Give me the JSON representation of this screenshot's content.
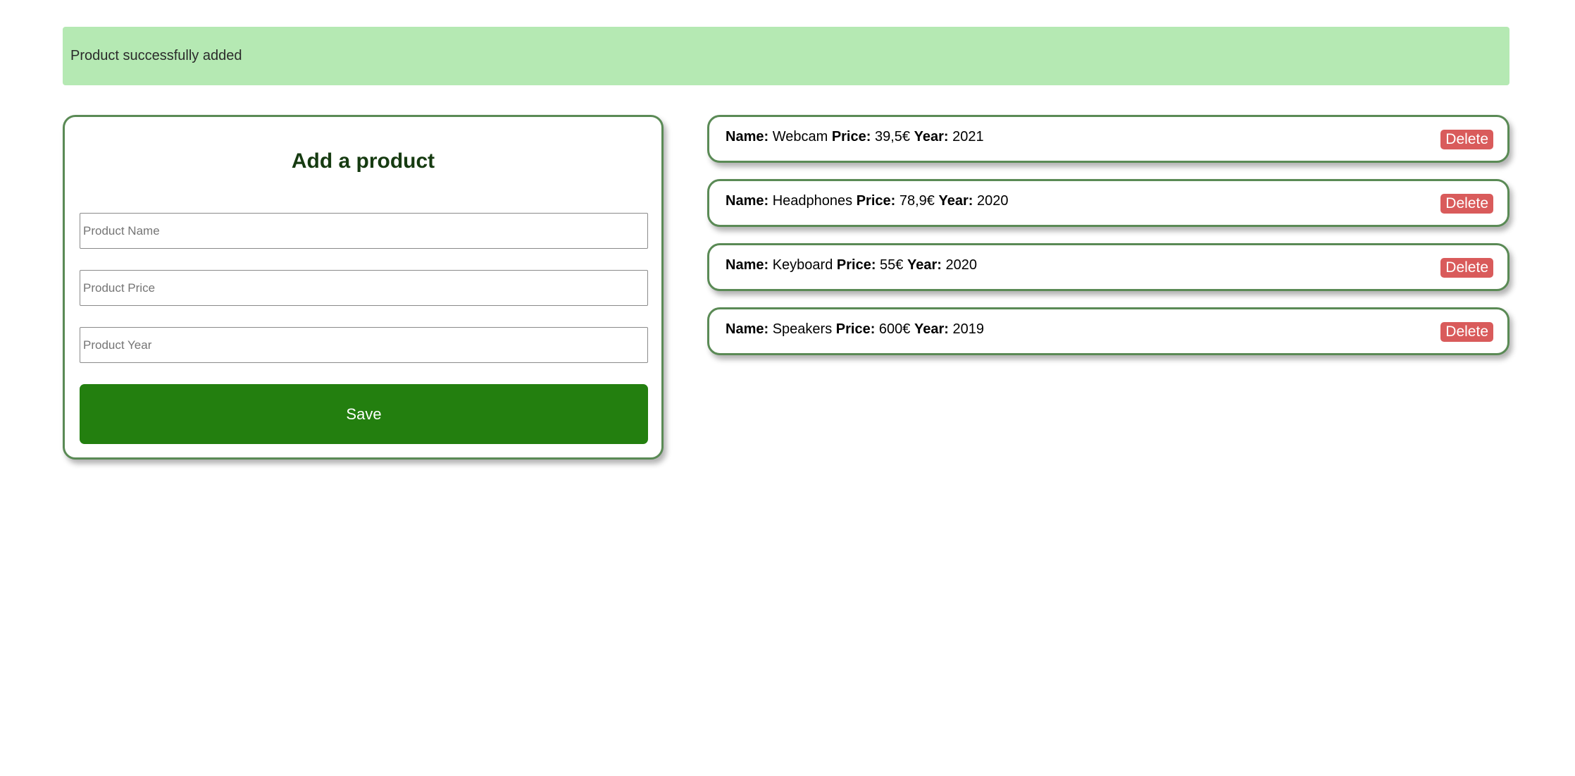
{
  "alert": {
    "message": "Product successfully added",
    "color": "#b5e9b3"
  },
  "form": {
    "title": "Add a product",
    "name_placeholder": "Product Name",
    "price_placeholder": "Product Price",
    "year_placeholder": "Product Year",
    "save_label": "Save",
    "accent": "#237f0f"
  },
  "labels": {
    "name": "Name:",
    "price": "Price:",
    "year": "Year:"
  },
  "products": [
    {
      "name": "Webcam",
      "price": "39,5€",
      "year": "2021",
      "delete_label": "Delete"
    },
    {
      "name": "Headphones",
      "price": "78,9€",
      "year": "2020",
      "delete_label": "Delete"
    },
    {
      "name": "Keyboard",
      "price": "55€",
      "year": "2020",
      "delete_label": "Delete"
    },
    {
      "name": "Speakers",
      "price": "600€",
      "year": "2019",
      "delete_label": "Delete"
    }
  ],
  "colors": {
    "border": "#5a8a55",
    "delete": "#d95b5b"
  }
}
